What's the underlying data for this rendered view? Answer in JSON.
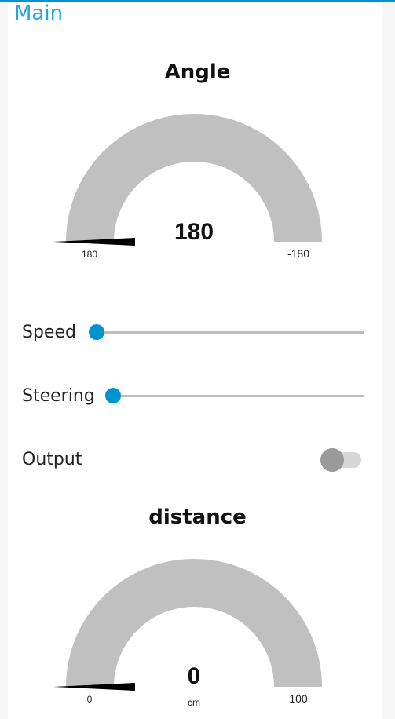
{
  "group": {
    "title": "Main"
  },
  "angle_gauge": {
    "title": "Angle",
    "value": "180",
    "min_label": "180",
    "max_label": "-180",
    "units": "",
    "fill_fraction": 0,
    "arc_color": "#c0c0c0",
    "needle_color": "#000000"
  },
  "speed": {
    "label": "Speed",
    "value_fraction": 0
  },
  "steering": {
    "label": "Steering",
    "value_fraction": 0
  },
  "output": {
    "label": "Output",
    "state": "off"
  },
  "distance_gauge": {
    "title": "distance",
    "value": "0",
    "min_label": "0",
    "max_label": "100",
    "units": "cm",
    "fill_fraction": 0,
    "arc_color": "#c0c0c0",
    "needle_color": "#000000"
  },
  "colors": {
    "accent": "#0094ce",
    "title": "#1fa7e0"
  }
}
